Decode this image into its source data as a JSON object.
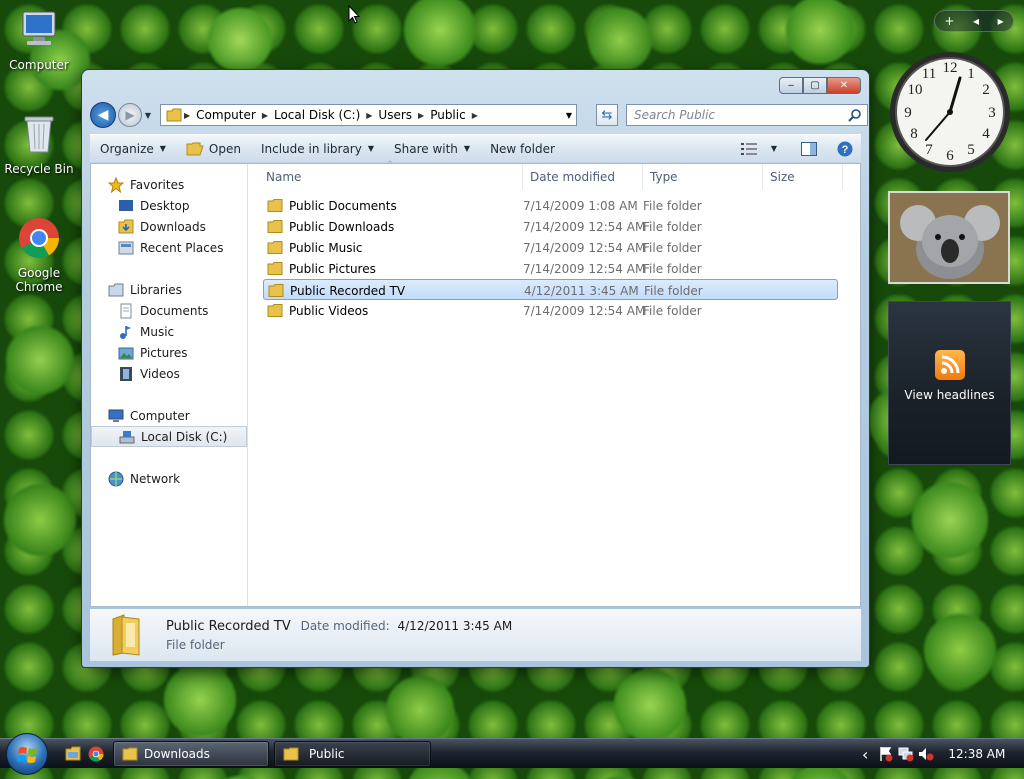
{
  "desktop": {
    "icons": [
      {
        "label": "Computer",
        "icon": "computer-icon"
      },
      {
        "label": "Recycle Bin",
        "icon": "recycle-bin-icon"
      },
      {
        "label": "Google Chrome",
        "icon": "chrome-icon"
      }
    ]
  },
  "gadgets": {
    "add_symbol": "+",
    "feed_label": "View headlines",
    "clock_numbers": [
      "12",
      "1",
      "2",
      "3",
      "4",
      "5",
      "6",
      "7",
      "8",
      "9",
      "10",
      "11"
    ]
  },
  "window": {
    "caption_buttons": {
      "minimize": "‒",
      "maximize": "▢",
      "close": "✕"
    },
    "address": {
      "segments": [
        "Computer",
        "Local Disk (C:)",
        "Users",
        "Public"
      ]
    },
    "search": {
      "placeholder": "Search Public"
    },
    "toolbar": {
      "organize": "Organize",
      "open": "Open",
      "include": "Include in library",
      "share": "Share with",
      "new_folder": "New folder"
    },
    "nav": {
      "favorites": "Favorites",
      "desktop": "Desktop",
      "downloads": "Downloads",
      "recent": "Recent Places",
      "libraries": "Libraries",
      "documents": "Documents",
      "music": "Music",
      "pictures": "Pictures",
      "videos": "Videos",
      "computer": "Computer",
      "local_disk": "Local Disk (C:)",
      "network": "Network"
    },
    "columns": {
      "name": "Name",
      "date": "Date modified",
      "type": "Type",
      "size": "Size"
    },
    "files": [
      {
        "name": "Public Documents",
        "date": "7/14/2009 1:08 AM",
        "type": "File folder"
      },
      {
        "name": "Public Downloads",
        "date": "7/14/2009 12:54 AM",
        "type": "File folder"
      },
      {
        "name": "Public Music",
        "date": "7/14/2009 12:54 AM",
        "type": "File folder"
      },
      {
        "name": "Public Pictures",
        "date": "7/14/2009 12:54 AM",
        "type": "File folder"
      },
      {
        "name": "Public Recorded TV",
        "date": "4/12/2011 3:45 AM",
        "type": "File folder"
      },
      {
        "name": "Public Videos",
        "date": "7/14/2009 12:54 AM",
        "type": "File folder"
      }
    ],
    "selected_index": 4,
    "details": {
      "name": "Public Recorded TV",
      "date_label": "Date modified:",
      "date_value": "4/12/2011 3:45 AM",
      "type": "File folder"
    }
  },
  "taskbar": {
    "buttons": [
      {
        "label": "Downloads",
        "state": "inactive"
      },
      {
        "label": "Public",
        "state": "active"
      }
    ],
    "tray_arrow": "‹",
    "time": "12:38 AM"
  },
  "colors": {
    "selection": "#c1dcfc",
    "accent": "#1b5aa8",
    "folder": "#e8c24a"
  }
}
